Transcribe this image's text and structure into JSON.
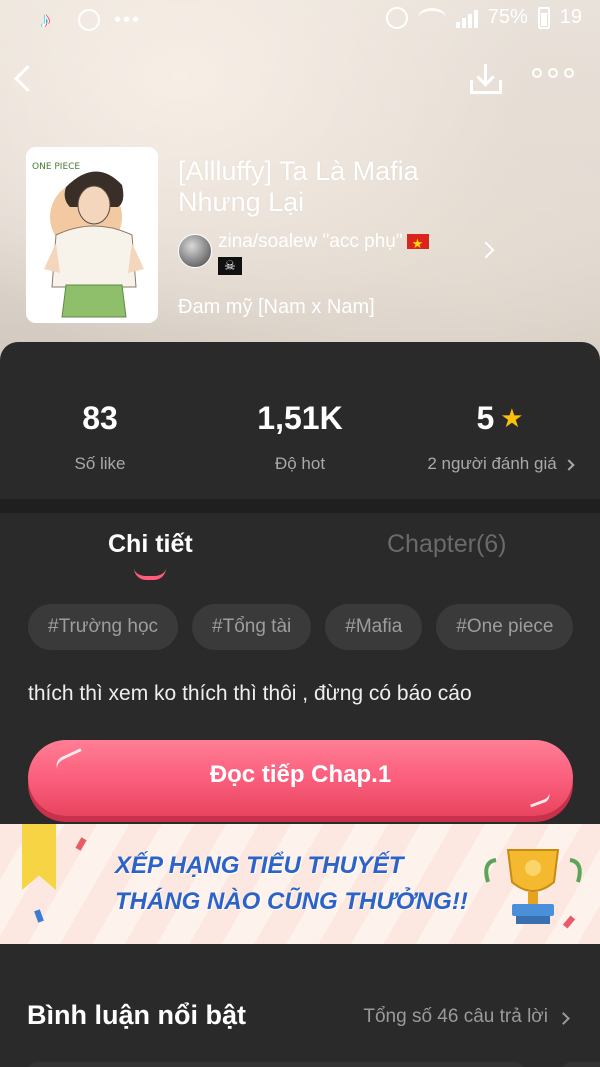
{
  "status_bar": {
    "battery": "75%",
    "time": "19"
  },
  "book": {
    "title": "[Allluffy] Ta Là Mafia Nhưng Lại",
    "author": "zina/soalew \"acc phụ\"",
    "genre": "Đam mỹ [Nam x Nam]",
    "cover_label": "ONE PIECE"
  },
  "stats": [
    {
      "value": "83",
      "label": "Số like"
    },
    {
      "value": "1,51K",
      "label": "Độ hot"
    },
    {
      "value": "5",
      "label": "2 người đánh giá"
    }
  ],
  "tabs": [
    {
      "label": "Chi tiết",
      "active": true
    },
    {
      "label": "Chapter(6)",
      "active": false
    }
  ],
  "tags": [
    "#Trường học",
    "#Tổng tài",
    "#Mafia",
    "#One piece"
  ],
  "description": "thích thì xem ko thích thì thôi , đừng có báo cáo",
  "read_button": "Đọc tiếp Chap.1",
  "banner": {
    "line1": "XẾP HẠNG TIỂU THUYẾT",
    "line2": "THÁNG NÀO CŨNG THƯỞNG!!"
  },
  "comments": {
    "title": "Bình luận nổi bật",
    "count_text": "Tổng số 46 câu trả lời"
  },
  "colors": {
    "accent": "#fb5f7d",
    "card_bg": "#2a2a2a",
    "star": "#ffc107",
    "banner_text": "#2c63c9"
  }
}
